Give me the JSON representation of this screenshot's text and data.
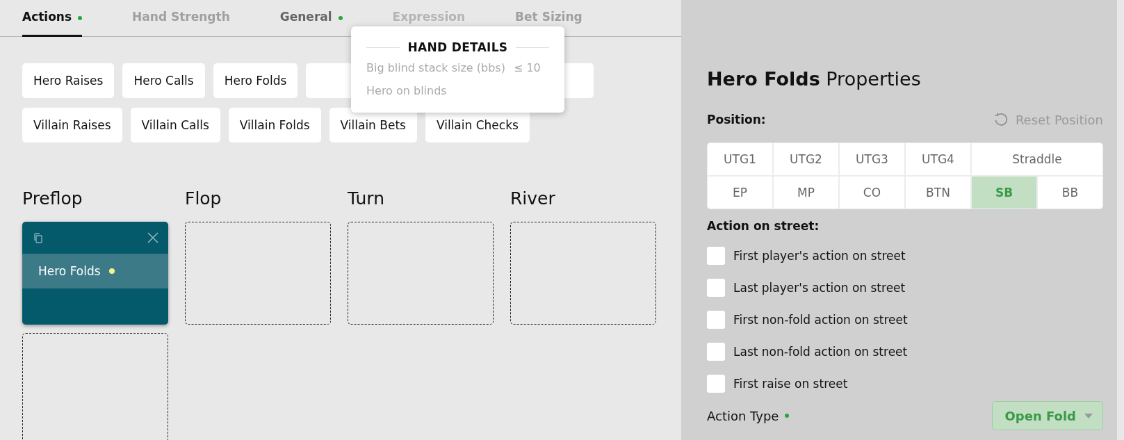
{
  "tabs": [
    {
      "label": "Actions",
      "selected": true,
      "dot": true,
      "disabled": false
    },
    {
      "label": "Hand Strength",
      "selected": false,
      "dot": false,
      "disabled": false
    },
    {
      "label": "General",
      "selected": false,
      "dot": true,
      "disabled": false
    },
    {
      "label": "Expression",
      "selected": false,
      "dot": false,
      "disabled": true
    },
    {
      "label": "Bet Sizing",
      "selected": false,
      "dot": false,
      "disabled": false
    }
  ],
  "popover": {
    "title": "HAND DETAILS",
    "rows": [
      {
        "label": "Big blind stack size (bbs)",
        "value": "≤ 10"
      },
      {
        "label": "Hero on blinds"
      }
    ]
  },
  "action_buttons": [
    [
      {
        "label": "Hero Raises"
      },
      {
        "label": "Hero Calls"
      },
      {
        "label": "Hero Folds"
      },
      {
        "kind": "covered"
      }
    ],
    [
      {
        "label": "Villain Raises"
      },
      {
        "label": "Villain Calls"
      },
      {
        "label": "Villain Folds"
      },
      {
        "label": "Villain Bets"
      },
      {
        "label": "Villain Checks"
      }
    ]
  ],
  "streets": [
    {
      "name": "Preflop",
      "cards": [
        {
          "label": "Hero Folds",
          "dot": true
        }
      ]
    },
    {
      "name": "Flop"
    },
    {
      "name": "Turn"
    },
    {
      "name": "River"
    }
  ],
  "properties": {
    "title_bold": "Hero Folds",
    "title": "Properties",
    "position_label": "Position:",
    "reset": "Reset Position",
    "positions": [
      {
        "label": "UTG1",
        "selected": false
      },
      {
        "label": "UTG2",
        "selected": false
      },
      {
        "label": "UTG3",
        "selected": false
      },
      {
        "label": "UTG4",
        "selected": false
      },
      {
        "label": "Straddle",
        "selected": false,
        "wide": true
      },
      {
        "label": "EP",
        "selected": false
      },
      {
        "label": "MP",
        "selected": false
      },
      {
        "label": "CO",
        "selected": false
      },
      {
        "label": "BTN",
        "selected": false
      },
      {
        "label": "SB",
        "selected": true
      },
      {
        "label": "BB",
        "selected": false
      }
    ],
    "action_label": "Action on street:",
    "options": [
      {
        "label": "First player's action on street",
        "checked": false
      },
      {
        "label": "Last player's action on street",
        "checked": false
      },
      {
        "label": "First non-fold action on street",
        "checked": false
      },
      {
        "label": "Last non-fold action on street",
        "checked": false
      },
      {
        "label": "First raise on street",
        "checked": false
      }
    ],
    "action_type": {
      "label": "Action Type",
      "dot": true,
      "value": "Open Fold"
    }
  }
}
